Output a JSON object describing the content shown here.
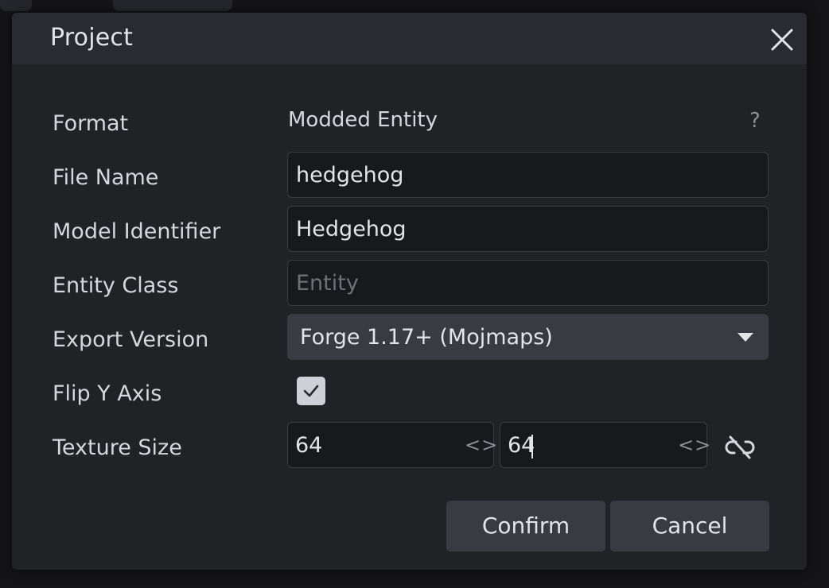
{
  "dialog": {
    "title": "Project"
  },
  "form": {
    "format": {
      "label": "Format",
      "value": "Modded Entity",
      "help": "?"
    },
    "file_name": {
      "label": "File Name",
      "value": "hedgehog"
    },
    "model_identifier": {
      "label": "Model Identifier",
      "value": "Hedgehog"
    },
    "entity_class": {
      "label": "Entity Class",
      "value": "",
      "placeholder": "Entity"
    },
    "export_version": {
      "label": "Export Version",
      "value": "Forge 1.17+ (Mojmaps)"
    },
    "flip_y_axis": {
      "label": "Flip Y Axis",
      "checked": true
    },
    "texture_size": {
      "label": "Texture Size",
      "width": "64",
      "height": "64",
      "stepper_glyph": "<>",
      "linked": false
    }
  },
  "buttons": {
    "confirm": "Confirm",
    "cancel": "Cancel"
  },
  "icons": {
    "close": "close-icon",
    "help": "help-icon",
    "dropdown": "caret-down-icon",
    "checkbox": "check-icon",
    "unlink": "link-off-icon"
  },
  "colors": {
    "dialog_bg": "#212226",
    "titlebar_bg": "#2a2b30",
    "input_bg": "#18191c",
    "button_bg": "#3a3b42",
    "text": "#e3e4e8",
    "muted": "#8d8e94"
  }
}
